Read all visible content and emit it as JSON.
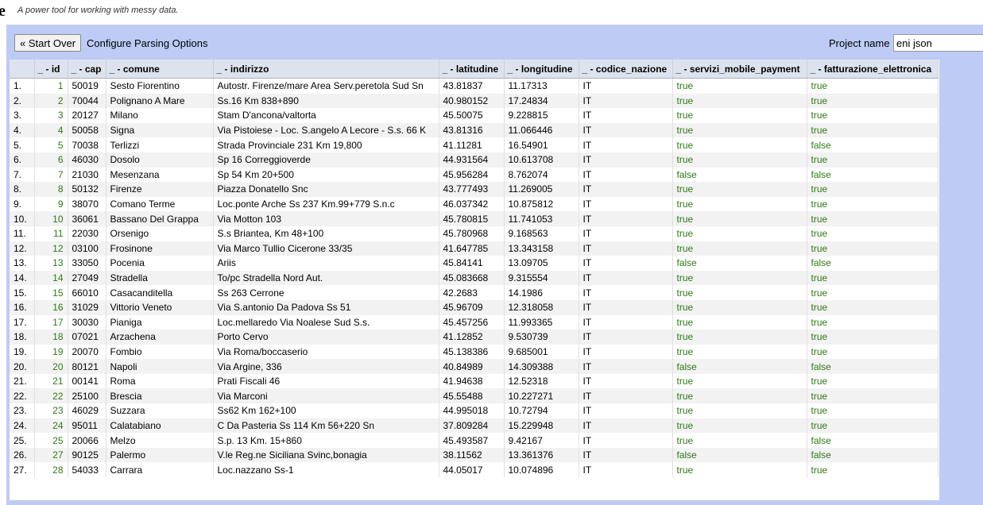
{
  "app": {
    "logo_letter": "e",
    "tagline": "A power tool for working with messy data."
  },
  "toolbar": {
    "start_over_label": "« Start Over",
    "configure_label": "Configure Parsing Options",
    "project_name_label": "Project name",
    "project_name_value": "eni json"
  },
  "columns": [
    "",
    "_ - id",
    "_ - cap",
    "_ - comune",
    "_ - indirizzo",
    "_ - latitudine",
    "_ - longitudine",
    "_ - codice_nazione",
    "_ - servizi_mobile_payment",
    "_ - fatturazione_elettronica"
  ],
  "rows": [
    [
      "1.",
      "1",
      "50019",
      "Sesto Fiorentino",
      "Autostr.  Firenze/mare   Area Serv.peretola Sud Sn",
      "43.81837",
      "11.17313",
      "IT",
      "true",
      "true"
    ],
    [
      "2.",
      "2",
      "70044",
      "Polignano A Mare",
      "Ss.16 Km 838+890",
      "40.980152",
      "17.24834",
      "IT",
      "true",
      "true"
    ],
    [
      "3.",
      "3",
      "20127",
      "Milano",
      "Stam D'ancona/valtorta",
      "45.50075",
      "9.228815",
      "IT",
      "true",
      "true"
    ],
    [
      "4.",
      "4",
      "50058",
      "Signa",
      "Via Pistoiese - Loc. S.angelo A Lecore - S.s. 66 K",
      "43.81316",
      "11.066446",
      "IT",
      "true",
      "true"
    ],
    [
      "5.",
      "5",
      "70038",
      "Terlizzi",
      "Strada Provinciale 231 Km 19,800",
      "41.11281",
      "16.54901",
      "IT",
      "true",
      "false"
    ],
    [
      "6.",
      "6",
      "46030",
      "Dosolo",
      "Sp 16 Correggioverde",
      "44.931564",
      "10.613708",
      "IT",
      "true",
      "true"
    ],
    [
      "7.",
      "7",
      "21030",
      "Mesenzana",
      "Sp 54 Km 20+500",
      "45.956284",
      "8.762074",
      "IT",
      "false",
      "false"
    ],
    [
      "8.",
      "8",
      "50132",
      "Firenze",
      "Piazza Donatello  Snc",
      "43.777493",
      "11.269005",
      "IT",
      "true",
      "true"
    ],
    [
      "9.",
      "9",
      "38070",
      "Comano Terme",
      "Loc.ponte Arche Ss 237 Km.99+779 S.n.c",
      "46.037342",
      "10.875812",
      "IT",
      "true",
      "true"
    ],
    [
      "10.",
      "10",
      "36061",
      "Bassano Del Grappa",
      "Via Motton 103",
      "45.780815",
      "11.741053",
      "IT",
      "true",
      "true"
    ],
    [
      "11.",
      "11",
      "22030",
      "Orsenigo",
      "S.s Briantea, Km 48+100",
      "45.780968",
      "9.168563",
      "IT",
      "true",
      "true"
    ],
    [
      "12.",
      "12",
      "03100",
      "Frosinone",
      "Via Marco Tullio Cicerone  33/35",
      "41.647785",
      "13.343158",
      "IT",
      "true",
      "true"
    ],
    [
      "13.",
      "13",
      "33050",
      "Pocenia",
      "Ariis",
      "45.84141",
      "13.09705",
      "IT",
      "false",
      "false"
    ],
    [
      "14.",
      "14",
      "27049",
      "Stradella",
      "To/pc Stradella Nord Aut.",
      "45.083668",
      "9.315554",
      "IT",
      "true",
      "true"
    ],
    [
      "15.",
      "15",
      "66010",
      "Casacanditella",
      "Ss 263 Cerrone",
      "42.2683",
      "14.1986",
      "IT",
      "true",
      "true"
    ],
    [
      "16.",
      "16",
      "31029",
      "Vittorio Veneto",
      "Via S.antonio Da Padova Ss 51",
      "45.96709",
      "12.318058",
      "IT",
      "true",
      "true"
    ],
    [
      "17.",
      "17",
      "30030",
      "Pianiga",
      "Loc.mellaredo Via Noalese Sud S.s.",
      "45.457256",
      "11.993365",
      "IT",
      "true",
      "true"
    ],
    [
      "18.",
      "18",
      "07021",
      "Arzachena",
      "Porto Cervo",
      "41.12852",
      "9.530739",
      "IT",
      "true",
      "true"
    ],
    [
      "19.",
      "19",
      "20070",
      "Fombio",
      "Via Roma/boccaserio",
      "45.138386",
      "9.685001",
      "IT",
      "true",
      "true"
    ],
    [
      "20.",
      "20",
      "80121",
      "Napoli",
      "Via Argine, 336",
      "40.84989",
      "14.309388",
      "IT",
      "false",
      "false"
    ],
    [
      "21.",
      "21",
      "00141",
      "Roma",
      "Prati Fiscali 46",
      "41.94638",
      "12.52318",
      "IT",
      "true",
      "true"
    ],
    [
      "22.",
      "22",
      "25100",
      "Brescia",
      "Via Marconi",
      "45.55488",
      "10.227271",
      "IT",
      "true",
      "true"
    ],
    [
      "23.",
      "23",
      "46029",
      "Suzzara",
      "Ss62 Km 162+100",
      "44.995018",
      "10.72794",
      "IT",
      "true",
      "true"
    ],
    [
      "24.",
      "24",
      "95011",
      "Calatabiano",
      "C Da Pasteria Ss 114 Km 56+220  Sn",
      "37.809284",
      "15.229948",
      "IT",
      "true",
      "true"
    ],
    [
      "25.",
      "25",
      "20066",
      "Melzo",
      "S.p. 13 Km. 15+860",
      "45.493587",
      "9.42167",
      "IT",
      "true",
      "false"
    ],
    [
      "26.",
      "27",
      "90125",
      "Palermo",
      "V.le Reg.ne Siciliana Svinc,bonagia",
      "38.11562",
      "13.361376",
      "IT",
      "false",
      "false"
    ],
    [
      "27.",
      "28",
      "54033",
      "Carrara",
      "Loc.nazzano Ss-1",
      "44.05017",
      "10.074896",
      "IT",
      "true",
      "true"
    ]
  ]
}
